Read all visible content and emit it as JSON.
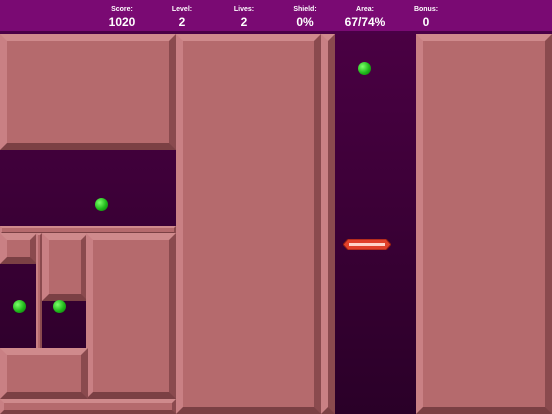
{
  "hud": {
    "score_label": "Score:",
    "score": "1020",
    "level_label": "Level:",
    "level": "2",
    "lives_label": "Lives:",
    "lives": "2",
    "shield_label": "Shield:",
    "shield": "0%",
    "area_label": "Area:",
    "area": "67/74%",
    "bonus_label": "Bonus:",
    "bonus": "0"
  },
  "colors": {
    "hud_bg": "#7a0a73",
    "open_area": "#3a0038",
    "filled_block": "#b56a6d",
    "ball": "#1fb81a",
    "cutter": "#e0402a"
  },
  "objects": {
    "balls": [
      "ball",
      "ball",
      "ball",
      "ball"
    ],
    "cutter": "horizontal-cutter"
  }
}
